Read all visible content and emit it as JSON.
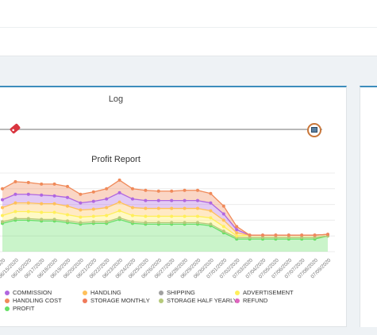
{
  "chart_data": {
    "type": "area",
    "title": "Profit Report",
    "xlabel": "",
    "ylabel": "",
    "stacked": true,
    "grid": true,
    "legend_position": "bottom",
    "categories": [
      "06/14/2020",
      "06/15/2020",
      "06/16/2020",
      "06/17/2020",
      "06/18/2020",
      "06/19/2020",
      "06/20/2020",
      "06/21/2020",
      "06/22/2020",
      "06/23/2020",
      "06/24/2020",
      "06/25/2020",
      "06/26/2020",
      "06/27/2020",
      "06/28/2020",
      "06/29/2020",
      "06/30/2020",
      "07/01/2020",
      "07/02/2020",
      "07/03/2020",
      "07/04/2020",
      "07/05/2020",
      "07/06/2020",
      "07/07/2020",
      "07/08/2020",
      "07/09/2020"
    ],
    "series": [
      {
        "name": "PROFIT",
        "color": "#66e066",
        "values": [
          36,
          40,
          40,
          39,
          39,
          37,
          35,
          36,
          36,
          41,
          36,
          35,
          35,
          35,
          35,
          35,
          33,
          24,
          16,
          16,
          16,
          16,
          16,
          16,
          16,
          20
        ]
      },
      {
        "name": "STORAGE HALF YEARLY",
        "color": "#b5c97a",
        "values": [
          2,
          2,
          2,
          2,
          2,
          2,
          2,
          2,
          2,
          2,
          2,
          2,
          2,
          2,
          2,
          2,
          2,
          2,
          2,
          2,
          2,
          2,
          2,
          2,
          2,
          0
        ]
      },
      {
        "name": "ADVERTISEMENT",
        "color": "#ffef5a",
        "values": [
          8,
          9,
          9,
          9,
          9,
          8,
          7,
          7,
          8,
          9,
          8,
          8,
          8,
          8,
          8,
          8,
          8,
          6,
          2,
          3,
          3,
          3,
          3,
          3,
          3,
          2
        ]
      },
      {
        "name": "HANDLING",
        "color": "#ffc05a",
        "values": [
          10,
          11,
          11,
          11,
          11,
          11,
          9,
          9,
          10,
          11,
          10,
          10,
          10,
          10,
          10,
          10,
          9,
          8,
          4,
          0,
          0,
          0,
          0,
          0,
          0,
          0
        ]
      },
      {
        "name": "COMMISSION",
        "color": "#b066e0",
        "values": [
          10,
          11,
          11,
          11,
          10,
          11,
          9,
          10,
          11,
          12,
          11,
          10,
          10,
          10,
          10,
          10,
          10,
          8,
          4,
          0,
          0,
          0,
          0,
          0,
          0,
          0
        ]
      },
      {
        "name": "HANDLING COST",
        "color": "#f08a5a",
        "values": [
          14,
          16,
          15,
          14,
          15,
          14,
          11,
          12,
          13,
          16,
          13,
          13,
          12,
          12,
          13,
          13,
          12,
          10,
          4,
          0,
          0,
          0,
          0,
          0,
          0,
          0
        ]
      }
    ],
    "legend": [
      {
        "name": "COMMISSION",
        "color": "#b066e0"
      },
      {
        "name": "HANDLING",
        "color": "#ffc05a"
      },
      {
        "name": "SHIPPING",
        "color": "#a0a0a0"
      },
      {
        "name": "ADVERTISEMENT",
        "color": "#ffef5a"
      },
      {
        "name": "HANDLING COST",
        "color": "#f08a5a"
      },
      {
        "name": "STORAGE MONTHLY",
        "color": "#f07a5a"
      },
      {
        "name": "STORAGE HALF YEARLY",
        "color": "#b5c97a"
      },
      {
        "name": "REFUND",
        "color": "#e066c0"
      },
      {
        "name": "PROFIT",
        "color": "#66e066"
      }
    ]
  },
  "slider": {
    "label": "Log",
    "left_icon": "tag-icon",
    "right_icon": "image-icon",
    "color": "#c9773a"
  }
}
